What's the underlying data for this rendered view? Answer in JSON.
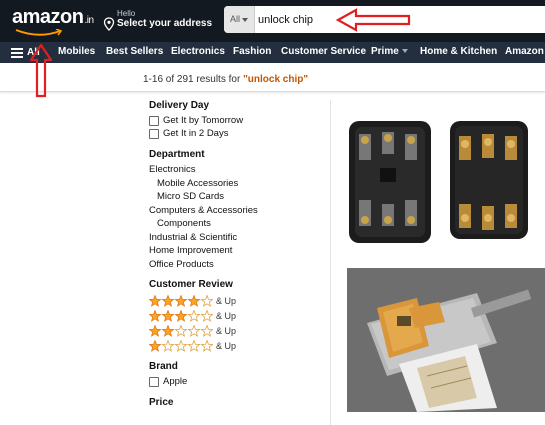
{
  "header": {
    "logo_text": "amazon",
    "logo_suffix": ".in",
    "deliver_hello": "Hello",
    "deliver_address": "Select your address",
    "search_category": "All",
    "search_query": "unlock chip"
  },
  "nav": {
    "all_label": "All",
    "items": [
      "Mobiles",
      "Best Sellers",
      "Electronics",
      "Fashion",
      "Customer Service",
      "Prime",
      "Home & Kitchen",
      "Amazon P"
    ]
  },
  "results": {
    "count_text": "1-16 of 291 results for ",
    "query_quoted": "\"unlock chip\""
  },
  "sidebar": {
    "delivery_title": "Delivery Day",
    "delivery_options": [
      "Get It by Tomorrow",
      "Get It in 2 Days"
    ],
    "department_title": "Department",
    "departments": [
      {
        "label": "Electronics",
        "indent": false
      },
      {
        "label": "Mobile Accessories",
        "indent": true
      },
      {
        "label": "Micro SD Cards",
        "indent": true
      },
      {
        "label": "Computers & Accessories",
        "indent": false
      },
      {
        "label": "Components",
        "indent": true
      },
      {
        "label": "Industrial & Scientific",
        "indent": false
      },
      {
        "label": "Home Improvement",
        "indent": false
      },
      {
        "label": "Office Products",
        "indent": false
      }
    ],
    "review_title": "Customer Review",
    "review_rows": [
      {
        "stars": 4,
        "label": "& Up"
      },
      {
        "stars": 3,
        "label": "& Up"
      },
      {
        "stars": 2,
        "label": "& Up"
      },
      {
        "stars": 1,
        "label": "& Up"
      }
    ],
    "brand_title": "Brand",
    "brands": [
      "Apple"
    ],
    "price_title": "Price"
  },
  "colors": {
    "header_bg": "#131921",
    "nav_bg": "#232f3e",
    "star": "#ffa41c",
    "annotation": "#e02020",
    "query_accent": "#c45500"
  }
}
